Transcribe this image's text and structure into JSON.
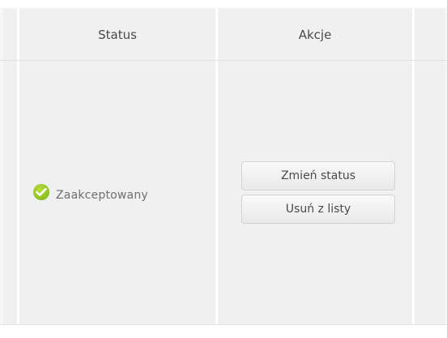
{
  "table": {
    "headers": {
      "status": "Status",
      "actions": "Akcje"
    },
    "row": {
      "status": {
        "icon": "check-circle-icon",
        "icon_color": "#8cbf1f",
        "text": "Zaakceptowany"
      },
      "actions": {
        "change_status_label": "Zmień status",
        "remove_label": "Usuń z listy"
      }
    }
  }
}
